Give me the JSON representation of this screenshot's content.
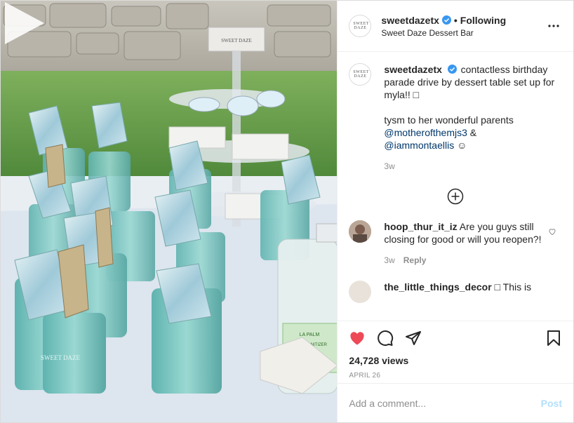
{
  "post": {
    "username": "sweetdazetx",
    "follow_status": "Following",
    "location": "Sweet Daze Dessert Bar",
    "avatar_text": "SWEET DAZE",
    "caption": {
      "username": "sweetdazetx",
      "line1": "contactless birthday parade drive by dessert table set up for myla!! □",
      "line2_prefix": "tysm to her wonderful parents",
      "mention1": "@motherofthemjs3",
      "amp": "&",
      "mention2": "@iammontaellis",
      "emoji": "☺",
      "time": "3w"
    },
    "comments": [
      {
        "username": "hoop_thur_it_iz",
        "text": "Are you guys still closing for good or will you reopen?!",
        "time": "3w",
        "reply_label": "Reply"
      },
      {
        "username": "the_little_things_decor",
        "text": "□ This is"
      }
    ],
    "views": "24,728 views",
    "date": "APRIL 26",
    "comment_placeholder": "Add a comment...",
    "post_label": "Post",
    "media_cup_label": "SWEET DAZE",
    "media_sign_label": "SWEET DAZE",
    "sanitizer_label": "HAND SANITIZER",
    "sanitizer_brand": "LA PALM"
  },
  "colors": {
    "like_red": "#ed4956",
    "verified_blue": "#3897f0",
    "link_blue": "#00376b",
    "post_disabled": "#b2dffc",
    "muted": "#8e8e8e"
  },
  "icons": [
    "verified-icon",
    "more-options-icon",
    "load-more-icon",
    "heart-icon",
    "comment-icon",
    "share-icon",
    "save-icon",
    "play-icon"
  ]
}
